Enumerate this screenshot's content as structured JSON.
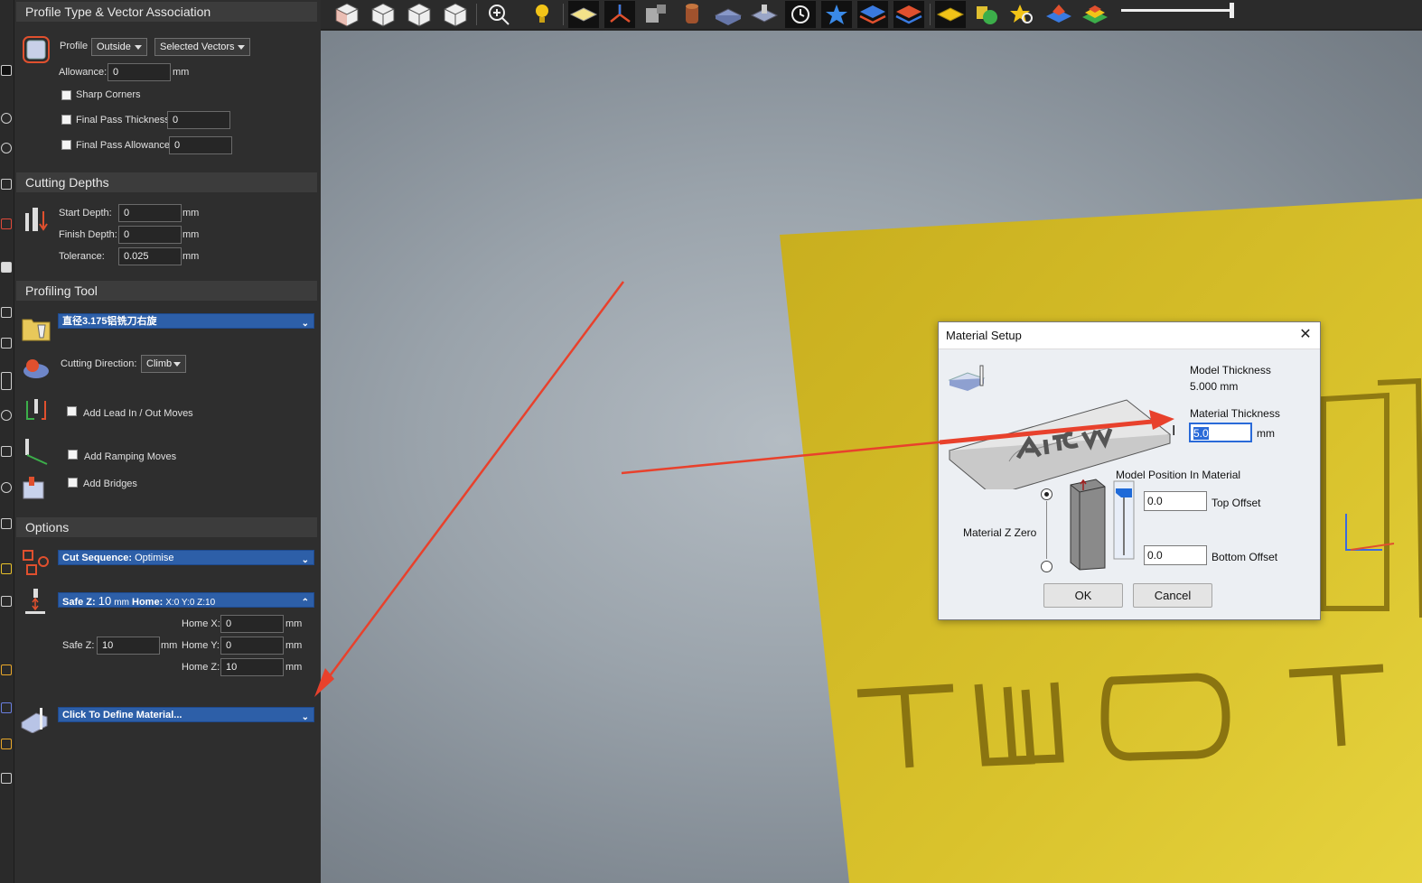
{
  "panel": {
    "profile_section": {
      "header": "Profile Type & Vector Association",
      "profile_label": "Profile",
      "profile_value": "Outside",
      "vectors_value": "Selected Vectors",
      "allowance_label": "Allowance:",
      "allowance_value": "0",
      "allowance_unit": "mm",
      "sharp_corners_label": "Sharp Corners",
      "final_pass_thickness_label": "Final Pass Thickness",
      "final_pass_thickness_value": "0",
      "final_pass_allowance_label": "Final Pass Allowance",
      "final_pass_allowance_value": "0"
    },
    "cutting_depths": {
      "header": "Cutting Depths",
      "start_label": "Start Depth:",
      "start_value": "0",
      "finish_label": "Finish Depth:",
      "finish_value": "0",
      "tolerance_label": "Tolerance:",
      "tolerance_value": "0.025",
      "unit": "mm"
    },
    "profiling_tool": {
      "header": "Profiling Tool",
      "tool_name": "直径3.175铝铣刀右旋",
      "direction_label": "Cutting Direction:",
      "direction_value": "Climb",
      "lead_label": "Add Lead In / Out Moves",
      "ramp_label": "Add Ramping Moves",
      "bridges_label": "Add Bridges"
    },
    "options": {
      "header": "Options",
      "cut_sequence_label": "Cut Sequence:",
      "cut_sequence_value": "Optimise",
      "safez_bar_label": "Safe Z:",
      "safez_bar_value": "10",
      "safez_bar_unit": "mm",
      "home_bar_label": "Home:",
      "home_bar_value": "X:0 Y:0 Z:10",
      "home_x_label": "Home X:",
      "home_x_value": "0",
      "home_y_label": "Home Y:",
      "home_y_value": "0",
      "home_z_label": "Home Z:",
      "home_z_value": "10",
      "safe_z_label": "Safe Z:",
      "safe_z_value": "10",
      "unit": "mm",
      "material_bar": "Click To Define Material..."
    }
  },
  "dialog": {
    "title": "Material Setup",
    "close": "✕",
    "model_thickness_label": "Model Thickness",
    "model_thickness_value": "5.000 mm",
    "material_thickness_label": "Material Thickness",
    "material_thickness_value": "5.0",
    "material_thickness_unit": "mm",
    "model_position_label": "Model Position In Material",
    "material_z_zero_label": "Material Z Zero",
    "top_offset_value": "0.0",
    "top_offset_label": "Top Offset",
    "bottom_offset_value": "0.0",
    "bottom_offset_label": "Bottom Offset",
    "ok_label": "OK",
    "cancel_label": "Cancel"
  },
  "colors": {
    "panel_bg": "#2e2e2e",
    "blue_bar": "#2d5fa8",
    "annotation_red": "#e8412c",
    "model_yellow": "#d8c12a"
  }
}
